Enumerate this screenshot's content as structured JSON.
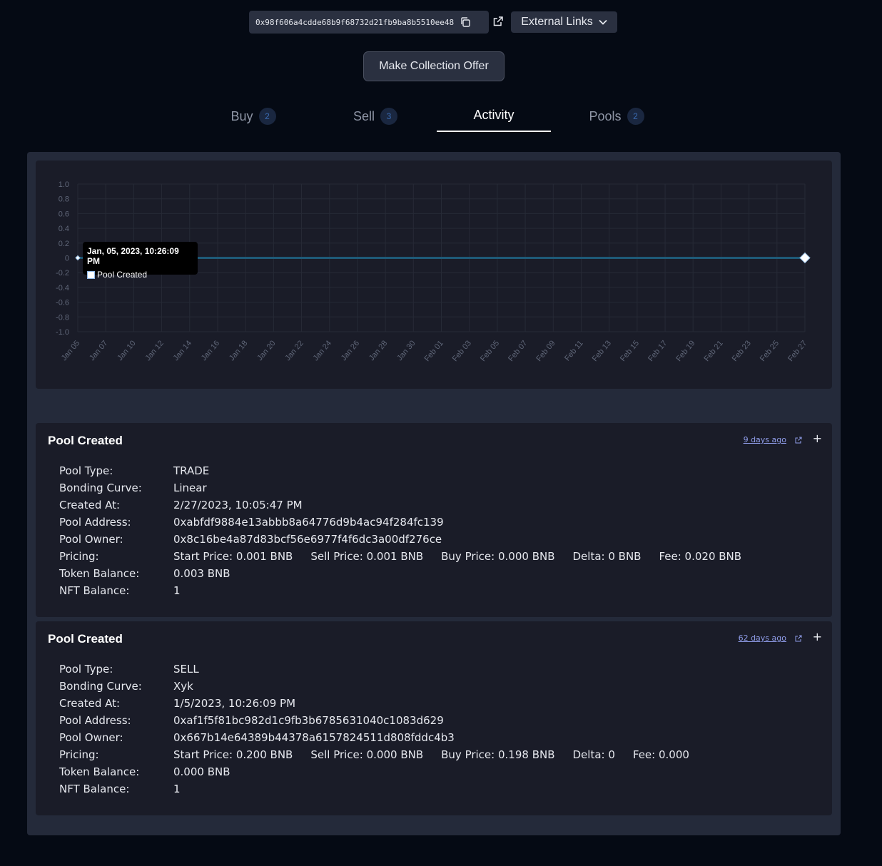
{
  "header": {
    "address": "0x98f606a4cdde68b9f68732d21fb9ba8b5510ee48",
    "external_links_label": "External Links"
  },
  "collection_offer_label": "Make Collection Offer",
  "tabs": [
    {
      "label": "Buy",
      "count": "2"
    },
    {
      "label": "Sell",
      "count": "3"
    },
    {
      "label": "Activity"
    },
    {
      "label": "Pools",
      "count": "2"
    }
  ],
  "chart_data": {
    "type": "line",
    "x": [
      "Jan 05",
      "Jan 07",
      "Jan 10",
      "Jan 12",
      "Jan 14",
      "Jan 16",
      "Jan 18",
      "Jan 20",
      "Jan 22",
      "Jan 24",
      "Jan 26",
      "Jan 28",
      "Jan 30",
      "Feb 01",
      "Feb 03",
      "Feb 05",
      "Feb 07",
      "Feb 09",
      "Feb 11",
      "Feb 13",
      "Feb 15",
      "Feb 17",
      "Feb 19",
      "Feb 21",
      "Feb 23",
      "Feb 25",
      "Feb 27"
    ],
    "y_ticks": [
      "1.0",
      "0.8",
      "0.6",
      "0.4",
      "0.2",
      "0",
      "-0.2",
      "-0.4",
      "-0.6",
      "-0.8",
      "-1.0"
    ],
    "ylim": [
      -1.0,
      1.0
    ],
    "series": [
      {
        "name": "Pool Created",
        "points": [
          {
            "x": "Jan 05",
            "y": 0
          },
          {
            "x": "Feb 27",
            "y": 0
          }
        ]
      }
    ],
    "tooltip": {
      "title": "Jan, 05, 2023, 10:26:09 PM",
      "label": "Pool Created"
    },
    "grid": true,
    "colors": {
      "line": "#1e5a78",
      "marker": "#ffffff"
    }
  },
  "activities": [
    {
      "title": "Pool Created",
      "time_ago": "9 days ago",
      "fields": {
        "pool_type_label": "Pool Type:",
        "pool_type": "TRADE",
        "bonding_curve_label": "Bonding Curve:",
        "bonding_curve": "Linear",
        "created_at_label": "Created At:",
        "created_at": "2/27/2023, 10:05:47 PM",
        "pool_address_label": "Pool Address:",
        "pool_address": "0xabfdf9884e13abbb8a64776d9b4ac94f284fc139",
        "pool_owner_label": "Pool Owner:",
        "pool_owner": "0x8c16be4a87d83bcf56e6977f4f6dc3a00df276ce",
        "pricing_label": "Pricing:",
        "pricing": [
          "Start Price: 0.001 BNB",
          "Sell Price: 0.001 BNB",
          "Buy Price: 0.000 BNB",
          "Delta: 0 BNB",
          "Fee: 0.020 BNB"
        ],
        "token_balance_label": "Token Balance:",
        "token_balance": "0.003 BNB",
        "nft_balance_label": "NFT Balance:",
        "nft_balance": "1"
      }
    },
    {
      "title": "Pool Created",
      "time_ago": "62 days ago",
      "fields": {
        "pool_type_label": "Pool Type:",
        "pool_type": "SELL",
        "bonding_curve_label": "Bonding Curve:",
        "bonding_curve": "Xyk",
        "created_at_label": "Created At:",
        "created_at": "1/5/2023, 10:26:09 PM",
        "pool_address_label": "Pool Address:",
        "pool_address": "0xaf1f5f81bc982d1c9fb3b6785631040c1083d629",
        "pool_owner_label": "Pool Owner:",
        "pool_owner": "0x667b14e64389b44378a6157824511d808fddc4b3",
        "pricing_label": "Pricing:",
        "pricing": [
          "Start Price: 0.200 BNB",
          "Sell Price: 0.000 BNB",
          "Buy Price: 0.198 BNB",
          "Delta: 0",
          "Fee: 0.000"
        ],
        "token_balance_label": "Token Balance:",
        "token_balance": "0.000 BNB",
        "nft_balance_label": "NFT Balance:",
        "nft_balance": "1"
      }
    }
  ]
}
